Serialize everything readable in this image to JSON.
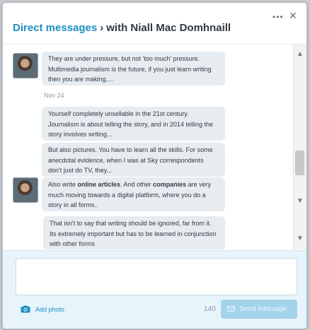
{
  "header": {
    "title_link": "Direct messages",
    "separator": "›",
    "title_rest": "with Niall Mac Domhnaill",
    "more_icon": "more-icon",
    "close_icon": "close-icon"
  },
  "conversation": {
    "date_divider": "Nov 24",
    "messages": [
      {
        "text": "They are under pressure, but not 'too much' pressure. Multimedia journalism is the future, if you just learn writing then you are making...."
      },
      {
        "text": "Yourself completely unsellable in the 21st century. Journalism is about telling the story, and in 2014 telling the story involves writing..."
      },
      {
        "text": "But also pictures. You have to learn all the skills. For some anecdotal evidence, when I was at Sky correspondents don't just do TV, they..."
      },
      {
        "part1": "Also write ",
        "bold1": "online articles",
        "part2": ". And other ",
        "bold2": "companies",
        "part3": " are very much moving towards a digital platform, where you do a story in all forms.."
      },
      {
        "text": "That isn't to say that writing should be ignored, far from it. Its extremely important but has to be learned in conjunction with other forms"
      }
    ]
  },
  "scrollbar": {
    "up_icon": "▲",
    "down_icon": "▼"
  },
  "composer": {
    "input_value": "",
    "add_photo_label": "Add photo",
    "char_count": "140",
    "send_label": "Send message"
  },
  "colors": {
    "accent": "#1b8fc2",
    "bubble": "#e6ecf0",
    "composer_bg": "#e8f4fb",
    "send_disabled": "#a4d3ec"
  }
}
